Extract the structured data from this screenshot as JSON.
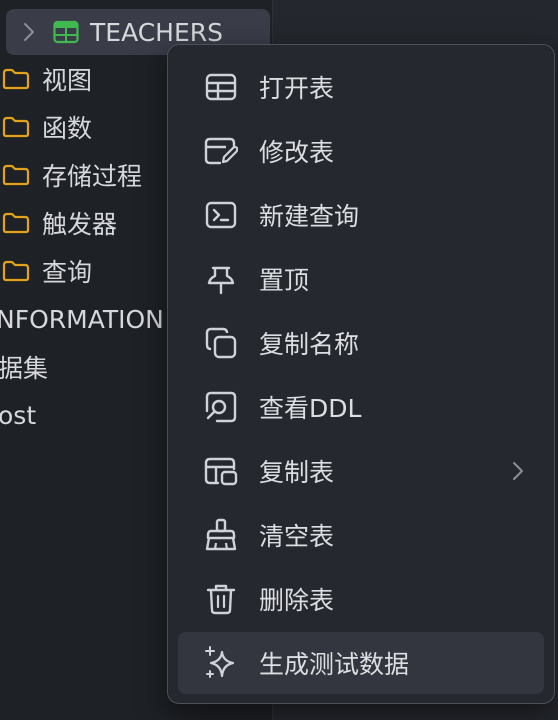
{
  "tree": {
    "selected_table": {
      "label": "TEACHERS",
      "icon": "table-icon",
      "icon_color": "#3fb950"
    },
    "folders": [
      {
        "label": "视图",
        "icon": "folder-icon"
      },
      {
        "label": "函数",
        "icon": "folder-icon"
      },
      {
        "label": "存储过程",
        "icon": "folder-icon"
      },
      {
        "label": "触发器",
        "icon": "folder-icon"
      },
      {
        "label": "查询",
        "icon": "folder-icon"
      }
    ],
    "other_items": [
      "NFORMATION",
      "据集",
      "ost"
    ],
    "folder_color": "#e3a21a"
  },
  "context_menu": {
    "items": [
      {
        "label": "打开表",
        "icon": "table-open-icon"
      },
      {
        "label": "修改表",
        "icon": "edit-table-icon"
      },
      {
        "label": "新建查询",
        "icon": "terminal-icon"
      },
      {
        "label": "置顶",
        "icon": "pin-icon"
      },
      {
        "label": "复制名称",
        "icon": "copy-icon"
      },
      {
        "label": "查看DDL",
        "icon": "view-ddl-icon"
      },
      {
        "label": "复制表",
        "icon": "duplicate-table-icon",
        "has_submenu": true
      },
      {
        "label": "清空表",
        "icon": "broom-icon"
      },
      {
        "label": "删除表",
        "icon": "trash-icon"
      },
      {
        "label": "生成测试数据",
        "icon": "sparkle-icon",
        "highlighted": true
      }
    ]
  }
}
